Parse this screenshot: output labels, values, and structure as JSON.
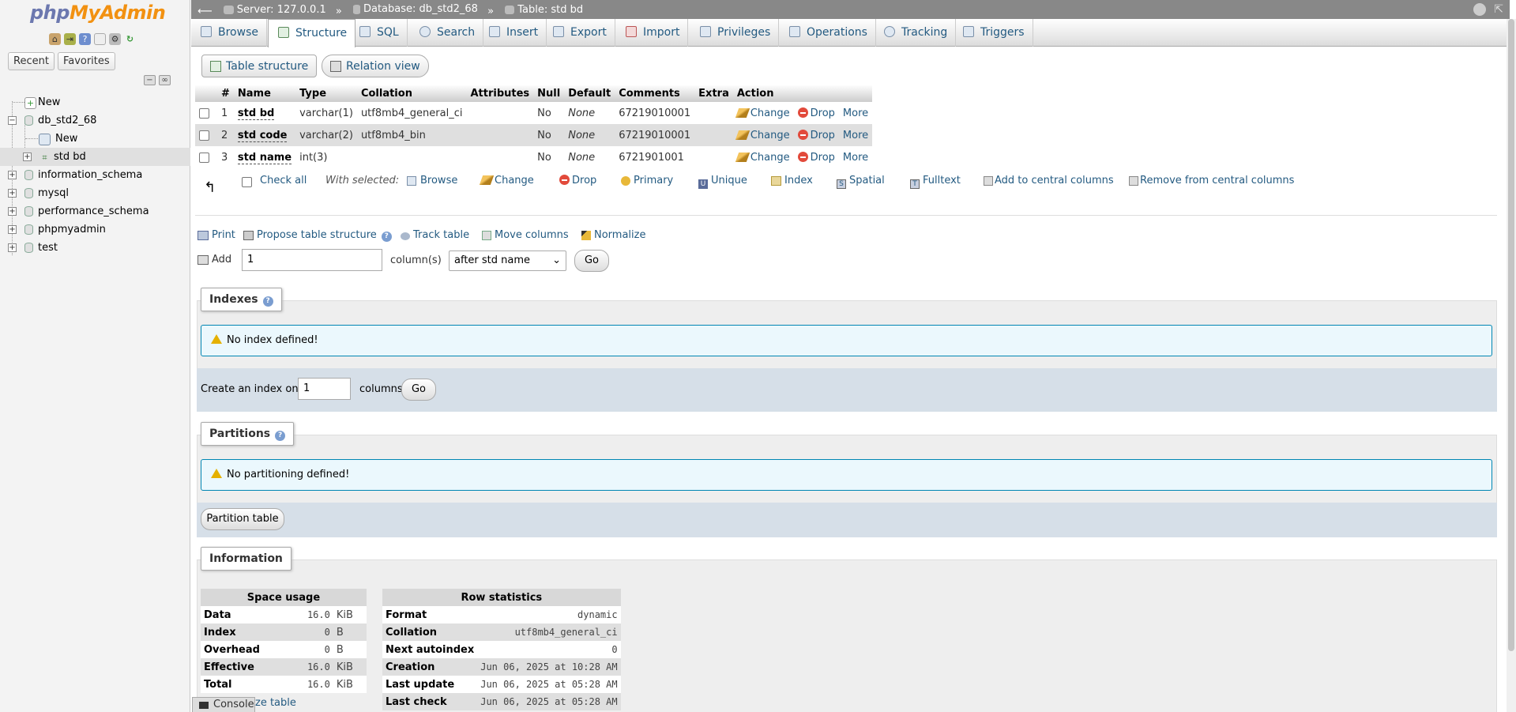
{
  "logo": {
    "part1": "php",
    "part2": "MyAdmin"
  },
  "sidebar": {
    "tabs": [
      "Recent",
      "Favorites"
    ],
    "tree": [
      {
        "label": "New"
      },
      {
        "label": "db_std2_68"
      },
      {
        "label": "New"
      },
      {
        "label": "std bd"
      },
      {
        "label": "information_schema"
      },
      {
        "label": "mysql"
      },
      {
        "label": "performance_schema"
      },
      {
        "label": "phpmyadmin"
      },
      {
        "label": "test"
      }
    ]
  },
  "breadcrumb": {
    "server": "Server: 127.0.0.1",
    "database": "Database: db_std2_68",
    "table": "Table: std bd",
    "sep": "»"
  },
  "tabs": [
    "Browse",
    "Structure",
    "SQL",
    "Search",
    "Insert",
    "Export",
    "Import",
    "Privileges",
    "Operations",
    "Tracking",
    "Triggers"
  ],
  "subtabs": {
    "structure": "Table structure",
    "relation": "Relation view"
  },
  "table": {
    "headers": [
      "#",
      "Name",
      "Type",
      "Collation",
      "Attributes",
      "Null",
      "Default",
      "Comments",
      "Extra",
      "Action"
    ],
    "rows": [
      {
        "num": "1",
        "name": "std bd",
        "type": "varchar(1)",
        "collation": "utf8mb4_general_ci",
        "null": "No",
        "default": "None",
        "comments": "67219010001"
      },
      {
        "num": "2",
        "name": "std code",
        "type": "varchar(2)",
        "collation": "utf8mb4_bin",
        "null": "No",
        "default": "None",
        "comments": "67219010001"
      },
      {
        "num": "3",
        "name": "std name",
        "type": "int(3)",
        "collation": "",
        "null": "No",
        "default": "None",
        "comments": "6721901001"
      }
    ],
    "actions": {
      "change": "Change",
      "drop": "Drop",
      "more": "More"
    }
  },
  "bulk": {
    "check_all": "Check all",
    "with_selected": "With selected:",
    "items": [
      "Browse",
      "Change",
      "Drop",
      "Primary",
      "Unique",
      "Index",
      "Spatial",
      "Fulltext",
      "Add to central columns",
      "Remove from central columns"
    ]
  },
  "tools": {
    "print": "Print",
    "propose": "Propose table structure",
    "track": "Track table",
    "move": "Move columns",
    "normalize": "Normalize"
  },
  "add": {
    "label": "Add",
    "value": "1",
    "columns": "column(s)",
    "position": "after std name",
    "go": "Go"
  },
  "indexes": {
    "title": "Indexes",
    "notice": "No index defined!",
    "create_label": "Create an index on",
    "create_value": "1",
    "columns": "columns",
    "go": "Go"
  },
  "partitions": {
    "title": "Partitions",
    "notice": "No partitioning defined!",
    "button": "Partition table"
  },
  "information": {
    "title": "Information",
    "space_title": "Space usage",
    "space": [
      {
        "k": "Data",
        "v": "16.0",
        "u": "KiB"
      },
      {
        "k": "Index",
        "v": "0",
        "u": "B"
      },
      {
        "k": "Overhead",
        "v": "0",
        "u": "B"
      },
      {
        "k": "Effective",
        "v": "16.0",
        "u": "KiB"
      },
      {
        "k": "Total",
        "v": "16.0",
        "u": "KiB"
      }
    ],
    "optimize": "ze table",
    "row_title": "Row statistics",
    "rows": [
      {
        "k": "Format",
        "v": "dynamic"
      },
      {
        "k": "Collation",
        "v": "utf8mb4_general_ci"
      },
      {
        "k": "Next autoindex",
        "v": "0"
      },
      {
        "k": "Creation",
        "v": "Jun 06, 2025 at 10:28 AM"
      },
      {
        "k": "Last update",
        "v": "Jun 06, 2025 at 05:28 AM"
      },
      {
        "k": "Last check",
        "v": "Jun 06, 2025 at 05:28 AM"
      }
    ]
  },
  "console": "Console"
}
